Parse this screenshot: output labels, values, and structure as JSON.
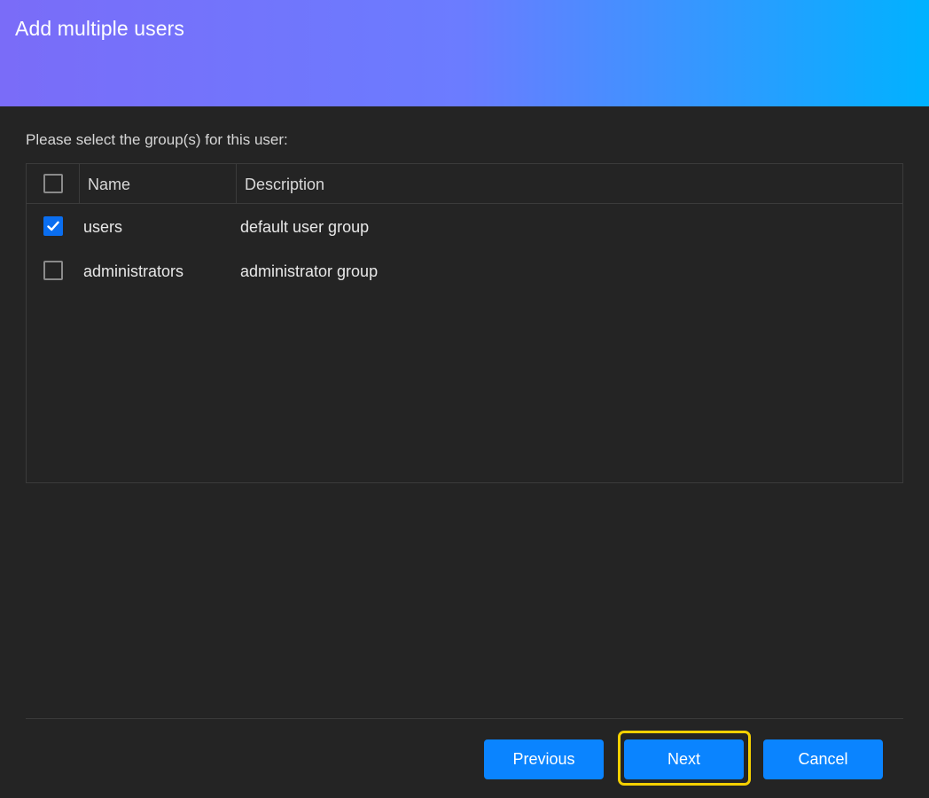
{
  "dialog": {
    "title": "Add multiple users",
    "instruction": "Please select the group(s) for this user:"
  },
  "table": {
    "columns": [
      "Name",
      "Description"
    ],
    "select_all_checked": false,
    "rows": [
      {
        "name": "users",
        "description": "default user group",
        "checked": true
      },
      {
        "name": "administrators",
        "description": "administrator group",
        "checked": false
      }
    ]
  },
  "buttons": {
    "previous": "Previous",
    "next": "Next",
    "cancel": "Cancel",
    "focused": "next"
  },
  "colors": {
    "accent": "#0a84ff",
    "focus": "#f5d000",
    "gradient_start": "#7a6cf8",
    "gradient_end": "#00b2ff"
  }
}
